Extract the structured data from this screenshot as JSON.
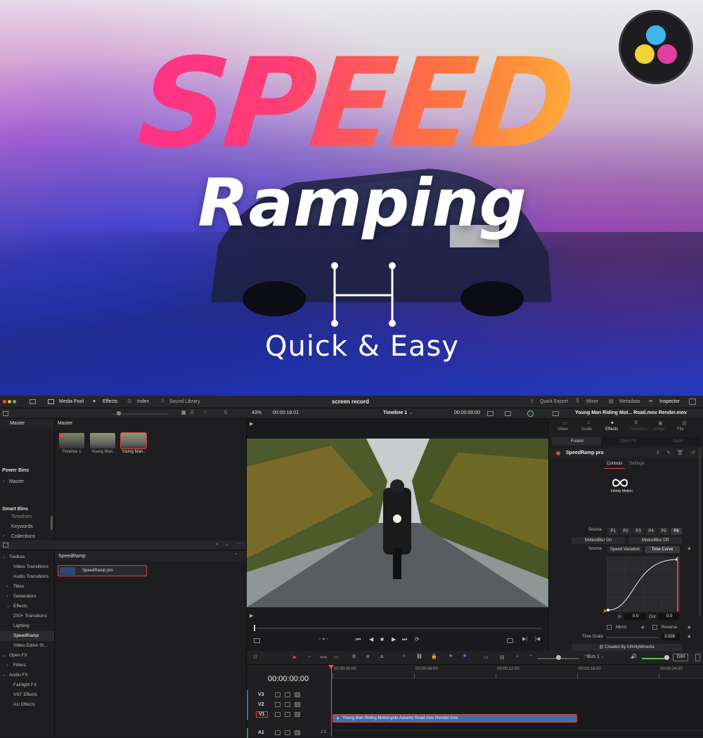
{
  "banner": {
    "title_top": "SPEED",
    "title_bottom": "Ramping",
    "subtitle": "Quick & Easy",
    "logo_icon": "davinci-resolve-logo"
  },
  "topbar": {
    "tabs": [
      "Media Pool",
      "Effects",
      "Index",
      "Sound Library"
    ],
    "project_title": "screen record",
    "right_tabs": [
      "Quick Export",
      "Mixer",
      "Metadata",
      "Inspector"
    ]
  },
  "toolbar2": {
    "zoom": "43%",
    "timecode_src": "00:00:18:01",
    "timeline_name": "Timeline 1",
    "timecode_rec": "00:00:00:00",
    "inspector_clip": "Young Man Riding Mot... Road.mov Render.mov"
  },
  "media_pool": {
    "bin_header": "Master",
    "content_header": "Master",
    "clips": [
      "Timeline 1",
      "Young Man...",
      "Young Man..."
    ],
    "power_bins_label": "Power Bins",
    "power_bins_items": [
      "Master"
    ],
    "smart_bins_label": "Smart Bins",
    "smart_bins_items": [
      "Timelines",
      "Keywords",
      "Collections"
    ]
  },
  "effects": {
    "tree": [
      {
        "label": "Toolbox",
        "level": 0,
        "expanded": true
      },
      {
        "label": "Video Transitions",
        "level": 2
      },
      {
        "label": "Audio Transitions",
        "level": 2
      },
      {
        "label": "Titles",
        "level": 1
      },
      {
        "label": "Generators",
        "level": 1
      },
      {
        "label": "Effects",
        "level": 1,
        "expanded": true
      },
      {
        "label": "200+ Transitions",
        "level": 2
      },
      {
        "label": "Lighting",
        "level": 2
      },
      {
        "label": "SpeedRamp",
        "level": 2,
        "selected": true
      },
      {
        "label": "Video Editor St...",
        "level": 2
      },
      {
        "label": "Open FX",
        "level": 0,
        "expanded": true
      },
      {
        "label": "Filters",
        "level": 1
      },
      {
        "label": "Audio FX",
        "level": 0,
        "expanded": true
      },
      {
        "label": "Fairlight FX",
        "level": 2
      },
      {
        "label": "VST Effects",
        "level": 2
      },
      {
        "label": "AU Effects",
        "level": 2
      }
    ],
    "category_header": "SpeedRamp",
    "item": "SpeedRamp pro"
  },
  "inspector": {
    "tabs": [
      "Video",
      "Audio",
      "Effects",
      "Transition",
      "Image",
      "File"
    ],
    "sub_tabs": [
      "Fusion",
      "Open FX",
      "Audio"
    ],
    "effect_name": "SpeedRamp pro",
    "mode_tabs": [
      "Controls",
      "Settings"
    ],
    "brand_name": "Infinity Motion",
    "source_label": "Source",
    "source_presets": [
      "P1",
      "P2",
      "P3",
      "P4",
      "P5",
      "P6"
    ],
    "motion_blur_on": "MotionBlur On",
    "motion_blur_off": "MotionBlur Off",
    "source_label2": "Source",
    "speed_variation": "Speed Variation",
    "time_curve": "Time Curve",
    "in_label": "In",
    "in_value": "0.0",
    "out_label": "Out",
    "out_value": "0.0",
    "mirror": "Mirror",
    "reverse": "Reverse",
    "time_scale_label": "Time Scale",
    "time_scale_value": "3.528",
    "credit": "@ Created By InfinityMmedia"
  },
  "timeline": {
    "timecode": "00:00:00:00",
    "ruler": [
      "00:00:00:00",
      "00:00:06:00",
      "00:00:12:00",
      "00:00:18:00",
      "00:00:24:00"
    ],
    "tracks": [
      "V3",
      "V2",
      "V1",
      "A1"
    ],
    "clip_name": "Young Man Riding Motorcycle Autumn Road.mov Render.mov",
    "bus": "Bus 1",
    "dim": "DIM",
    "audio_level": "2.0"
  },
  "colors": {
    "accent_red": "#d9443a",
    "clip_blue": "#3f6fa0",
    "panel_bg": "#1e1e20"
  }
}
